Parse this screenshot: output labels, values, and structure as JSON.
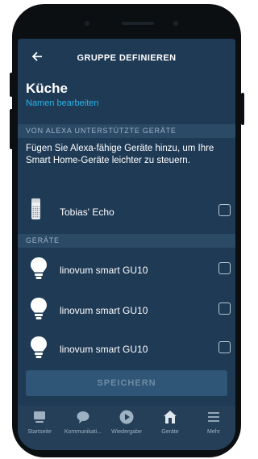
{
  "appbar": {
    "back_icon": "arrow-left-icon",
    "title": "GRUPPE DEFINIEREN"
  },
  "group": {
    "name": "Küche",
    "rename_label": "Namen bearbeiten"
  },
  "alexa_section": {
    "header": "VON ALEXA UNTERSTÜTZTE GERÄTE",
    "info": "Fügen Sie Alexa-fähige Geräte hinzu, um Ihre Smart Home-Geräte leichter zu steuern.",
    "devices": [
      {
        "name": "Tobias' Echo",
        "icon": "echo-speaker-icon",
        "checked": false
      }
    ]
  },
  "devices_section": {
    "header": "GERÄTE",
    "devices": [
      {
        "name": "linovum smart GU10",
        "icon": "light-bulb-icon",
        "checked": false
      },
      {
        "name": "linovum smart GU10",
        "icon": "light-bulb-icon",
        "checked": false
      },
      {
        "name": "linovum smart GU10",
        "icon": "light-bulb-icon",
        "checked": false
      }
    ]
  },
  "save_label": "SPEICHERN",
  "nav": [
    {
      "label": "Startseite",
      "icon": "home-icon"
    },
    {
      "label": "Kommunikati...",
      "icon": "chat-bubble-icon"
    },
    {
      "label": "Wiedergabe",
      "icon": "play-icon"
    },
    {
      "label": "Geräte",
      "icon": "smart-home-icon"
    },
    {
      "label": "Mehr",
      "icon": "menu-icon"
    }
  ],
  "colors": {
    "screen_bg": "#1f3a55",
    "accent": "#27b6ea",
    "section_bg": "#2b4a66",
    "save_bg": "#2f5677"
  }
}
